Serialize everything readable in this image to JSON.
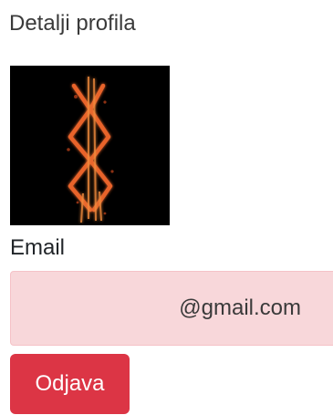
{
  "profile": {
    "title": "Detalji profila",
    "email_label": "Email",
    "email_value": "@gmail.com",
    "logout_label": "Odjava"
  },
  "colors": {
    "email_box_bg": "#f8d7da",
    "logout_bg": "#dc3545",
    "avatar_glyph": "#e8632a"
  },
  "icons": {
    "avatar": "brand-of-sacrifice-rune"
  }
}
